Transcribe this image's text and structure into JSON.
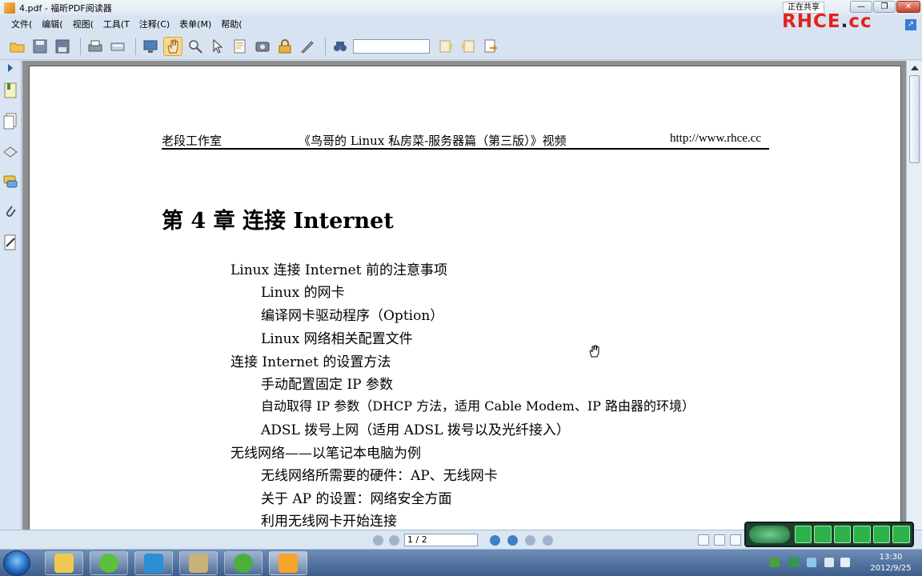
{
  "window": {
    "title": "4.pdf - 福昕PDF阅读器",
    "share_status": "正在共享",
    "minimize": "—",
    "maximize": "❐",
    "close": "✕"
  },
  "watermark": {
    "text_main": "RHCE",
    "text_dot": ".",
    "text_cc": "cc"
  },
  "menu": [
    {
      "label": "文件("
    },
    {
      "label": "编辑("
    },
    {
      "label": "视图("
    },
    {
      "label": "工具(T"
    },
    {
      "label": "注释(C)"
    },
    {
      "label": "表单(M)"
    },
    {
      "label": "帮助("
    }
  ],
  "toolbar": {
    "icons": [
      "open-folder-icon",
      "save-icon",
      "save-as-icon",
      "print-icon",
      "scan-icon",
      "fullscreen-icon",
      "hand-tool-icon",
      "zoom-tool-icon",
      "select-arrow-icon",
      "text-select-icon",
      "snapshot-icon",
      "rms-lock-icon",
      "sign-icon",
      "find-binoculars-icon",
      "search-prev-icon",
      "search-next-icon",
      "export-icon"
    ],
    "search_value": ""
  },
  "document": {
    "header_left": "老段工作室",
    "header_center": "《鸟哥的 Linux 私房菜-服务器篇（第三版）》视频",
    "header_right": "http://www.rhce.cc",
    "chapter_title": "第 4 章  连接  Internet",
    "toc": [
      {
        "text": "Linux  连接  Internet  前的注意事项",
        "level": 1
      },
      {
        "text": "Linux  的网卡",
        "level": 2
      },
      {
        "text": "编译网卡驱动程序（Option）",
        "level": 2
      },
      {
        "text": "Linux  网络相关配置文件",
        "level": 2
      },
      {
        "text": "连接  Internet  的设置方法",
        "level": 1
      },
      {
        "text": "手动配置固定 IP 参数",
        "level": 2
      },
      {
        "text": "自动取得 IP 参数（DHCP 方法，适用 Cable Modem、IP 路由器的环境）",
        "level": 2
      },
      {
        "text": "ADSL  拨号上网（适用 ADSL 拨号以及光纤接入）",
        "level": 2
      },
      {
        "text": "无线网络——以笔记本电脑为例",
        "level": 1
      },
      {
        "text": "无线网络所需要的硬件：AP、无线网卡",
        "level": 2
      },
      {
        "text": "关于 AP 的设置：网络安全方面",
        "level": 2
      },
      {
        "text": "利用无线网卡开始连接",
        "level": 2
      }
    ]
  },
  "statusbar": {
    "page_indicator": "1 / 2"
  },
  "taskbar": {
    "apps": [
      "file-explorer",
      "browser-refresh",
      "qq-app",
      "mail-app",
      "parrot-app",
      "foxit-app"
    ],
    "time": "13:30",
    "date": "2012/9/25"
  }
}
